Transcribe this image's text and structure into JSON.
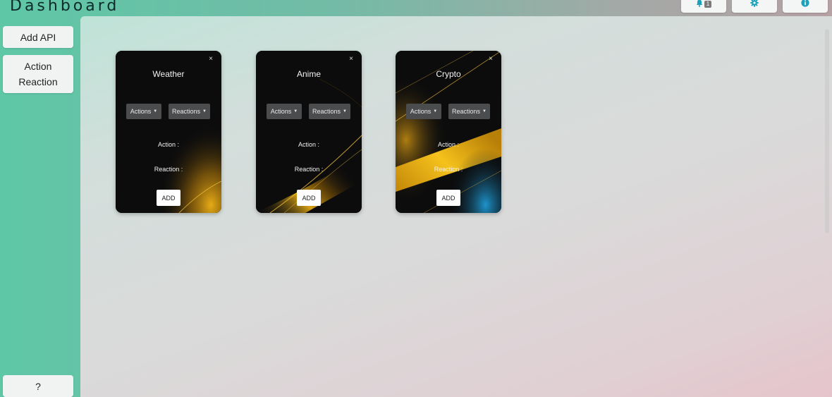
{
  "header": {
    "title": "Dashboard",
    "notifications_count": "1"
  },
  "sidebar": {
    "add_api": "Add API",
    "action_reaction_line1": "Action",
    "action_reaction_line2": "Reaction",
    "help": "?"
  },
  "cards": [
    {
      "title": "Weather",
      "close": "×",
      "actions_label": "Actions",
      "reactions_label": "Reactions",
      "action_label": "Action :",
      "reaction_label": "Reaction :",
      "add_label": "ADD"
    },
    {
      "title": "Anime",
      "close": "×",
      "actions_label": "Actions",
      "reactions_label": "Reactions",
      "action_label": "Action :",
      "reaction_label": "Reaction :",
      "add_label": "ADD"
    },
    {
      "title": "Crypto",
      "close": "×",
      "actions_label": "Actions",
      "reactions_label": "Reactions",
      "action_label": "Action :",
      "reaction_label": "Reaction :",
      "add_label": "ADD"
    }
  ],
  "icons": {
    "notifications": "bell-icon",
    "settings": "gear-icon",
    "info": "info-icon"
  },
  "colors": {
    "accent": "#1aa3b8",
    "card_gold": "#f0b316",
    "card_blue": "#1e9bd6"
  }
}
